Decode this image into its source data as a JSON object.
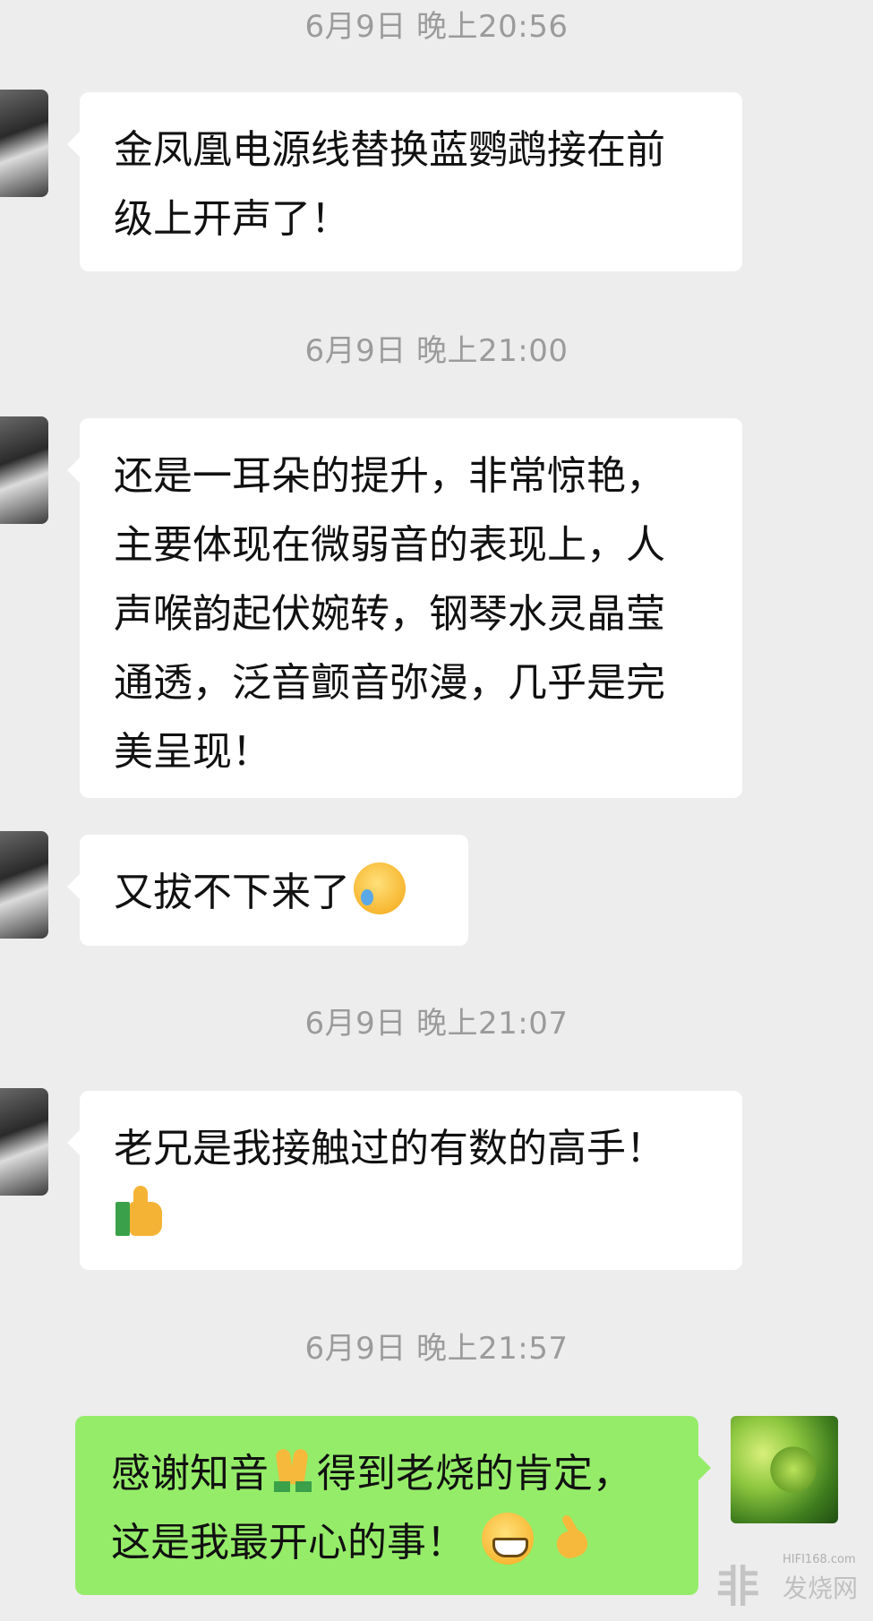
{
  "timestamps": [
    "6月9日 晚上20:56",
    "6月9日 晚上21:00",
    "6月9日 晚上21:07",
    "6月9日 晚上21:57"
  ],
  "messages": [
    {
      "lines": [
        "金凤凰电源线替换蓝鹦鹉接在前",
        "级上开声了！"
      ]
    },
    {
      "lines": [
        "还是一耳朵的提升，非常惊艳，",
        "主要体现在微弱音的表现上，人",
        "声喉韵起伏婉转，钢琴水灵晶莹",
        "通透，泛音颤音弥漫，几乎是完",
        "美呈现！"
      ]
    },
    {
      "text": "又拔不下来了",
      "emoji": "facepalm-crying-emoji"
    },
    {
      "text": "老兄是我接触过的有数的高手！",
      "emoji": "thumbs-up-emoji"
    },
    {
      "line1_a": "感谢知音",
      "line1_b": "得到老烧的肯定，",
      "line2": "这是我最开心的事！",
      "emojis": [
        "pray-emoji",
        "grin-emoji",
        "ok-hand-emoji"
      ]
    }
  ],
  "watermark": {
    "logo": "非",
    "site": "HIFI168.com",
    "name": "发烧网"
  },
  "colors": {
    "background": "#ededed",
    "incoming_bubble": "#ffffff",
    "outgoing_bubble": "#95ec69",
    "timestamp": "#9b9b9b"
  }
}
